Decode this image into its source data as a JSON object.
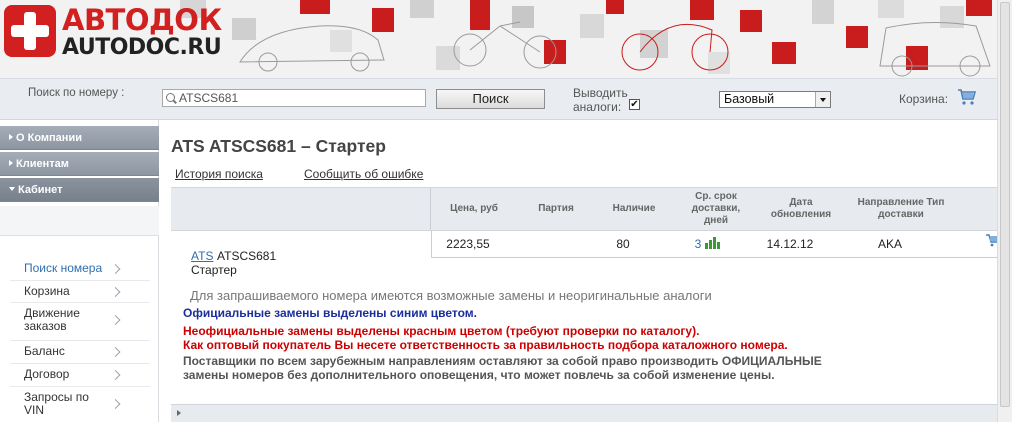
{
  "brand": {
    "logo_ru": "АВТОДОК",
    "logo_en": "AUTODOC.RU",
    "accent_color": "#d21f1f"
  },
  "searchbar": {
    "label": "Поиск по номеру :",
    "input_value": "ATSCS681",
    "button_label": "Поиск",
    "analogs_label": "Выводить аналоги:",
    "analogs_checked": "✔",
    "price_select_value": "Базовый",
    "cart_label": "Корзина:"
  },
  "sidebar": {
    "top": [
      "О Компании",
      "Клиентам",
      "Кабинет"
    ],
    "items": [
      "Поиск номера",
      "Корзина",
      "Движение заказов",
      "Баланс",
      "Договор",
      "Запросы по VIN"
    ]
  },
  "main": {
    "title": "ATS ATSCS681 – Стартер",
    "link_history": "История поиска",
    "link_report": "Сообщить об ошибке",
    "columns": {
      "price": "Цена, руб",
      "party": "Партия",
      "stock": "Наличие",
      "delivery": "Ср. срок доставки, дней",
      "updated": "Дата обновления",
      "direction": "Направление Тип доставки"
    },
    "row": {
      "price": "2223,55",
      "party": "",
      "stock": "80",
      "days": "3",
      "updated": "14.12.12",
      "direction": "AKA"
    },
    "part": {
      "brand": "ATS",
      "number": "ATSCS681",
      "name": "Стартер"
    },
    "notices": {
      "gray": "Для запрашиваемого номера имеются возможные замены и неоригинальные аналоги",
      "blue": "Официальные замены выделены синим цветом.",
      "red1": "Неофициальные замены выделены красным цветом (требуют проверки по каталогу).",
      "red2": "Как оптовый покупатель Вы несете ответственность за правильность подбора каталожного номера.",
      "suppliers": "Поставщики по всем зарубежным направлениям оставляют за собой право производить ОФИЦИАЛЬНЫЕ замены номеров без дополнительного оповещения, что может повлечь за собой изменение цены."
    }
  },
  "colors": {
    "link_blue": "#2e6fb1",
    "notice_blue": "#1a2e9c",
    "notice_red": "#cc0000"
  }
}
